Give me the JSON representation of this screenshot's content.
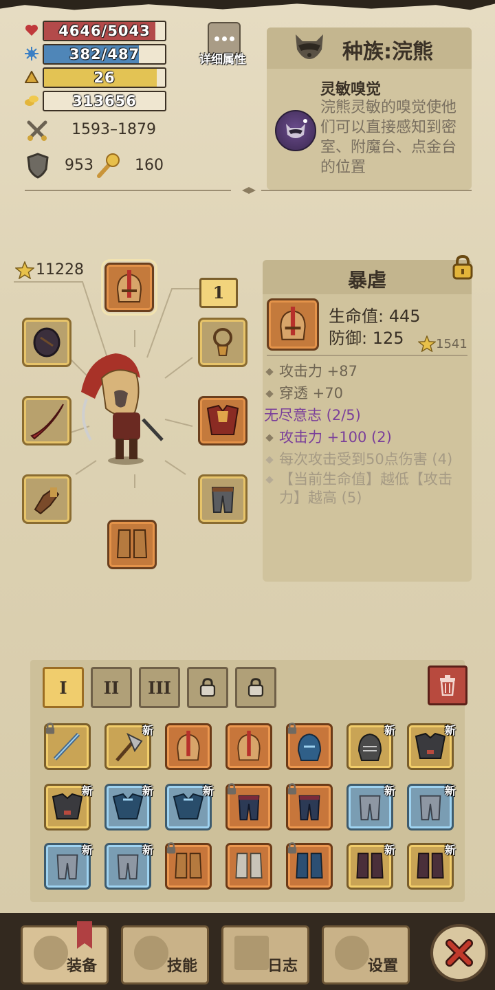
{
  "stats": {
    "hp": {
      "text": "4646/5043",
      "fraction": 0.921,
      "color": "#b34a4a"
    },
    "mana": {
      "text": "382/487",
      "fraction": 0.784,
      "color": "#4f86b8"
    },
    "level": {
      "text": "26",
      "fraction": 0.93,
      "color": "#e3c354"
    },
    "gold": {
      "text": "313656",
      "fraction": 0,
      "color": "#efe6d0"
    },
    "attack_range": "1593–1879",
    "defense": "953",
    "magic": "160"
  },
  "detail_attrs_button": "详细属性",
  "race": {
    "title": "种族:浣熊",
    "trait_name": "灵敏嗅觉",
    "trait_desc": "浣熊灵敏的嗅觉使他们可以直接感知到密室、附魔台、点金台的位置"
  },
  "character": {
    "score": "11228",
    "level_marker": "1"
  },
  "item_detail": {
    "name": "暴虐",
    "hp_line": "生命值: 445",
    "def_line": "防御: 125",
    "score": "1541",
    "attributes": [
      "攻击力 +87",
      "穿透 +70"
    ],
    "set_name": "无尽意志 (2/5)",
    "set_active": "攻击力 +100 (2)",
    "set_inactive": [
      "每次攻击受到50点伤害 (4)",
      "【当前生命值】越低【攻击力】越高 (5)"
    ]
  },
  "inventory": {
    "tabs": [
      "I",
      "II",
      "III"
    ],
    "new_label": "新",
    "rows": [
      [
        "weapon-sword",
        "weapon-axe",
        "helmet",
        "helmet",
        "helmet-blue",
        "helmet-iron",
        "armor-dark"
      ],
      [
        "armor-dark",
        "armor-blue",
        "armor-blue",
        "pants-dark",
        "pants-dark",
        "pants-gray",
        "pants-gray"
      ],
      [
        "pants-gray",
        "pants-gray",
        "boots",
        "boots-steel",
        "boots-blue",
        "boots-dark",
        "boots-dark"
      ]
    ]
  },
  "nav": {
    "equip": "装备",
    "skills": "技能",
    "journal": "日志",
    "settings": "设置"
  },
  "colors": {
    "accent_gold": "#e3c354",
    "purple_text": "#7a3f9a",
    "close_red": "#c0392b"
  }
}
